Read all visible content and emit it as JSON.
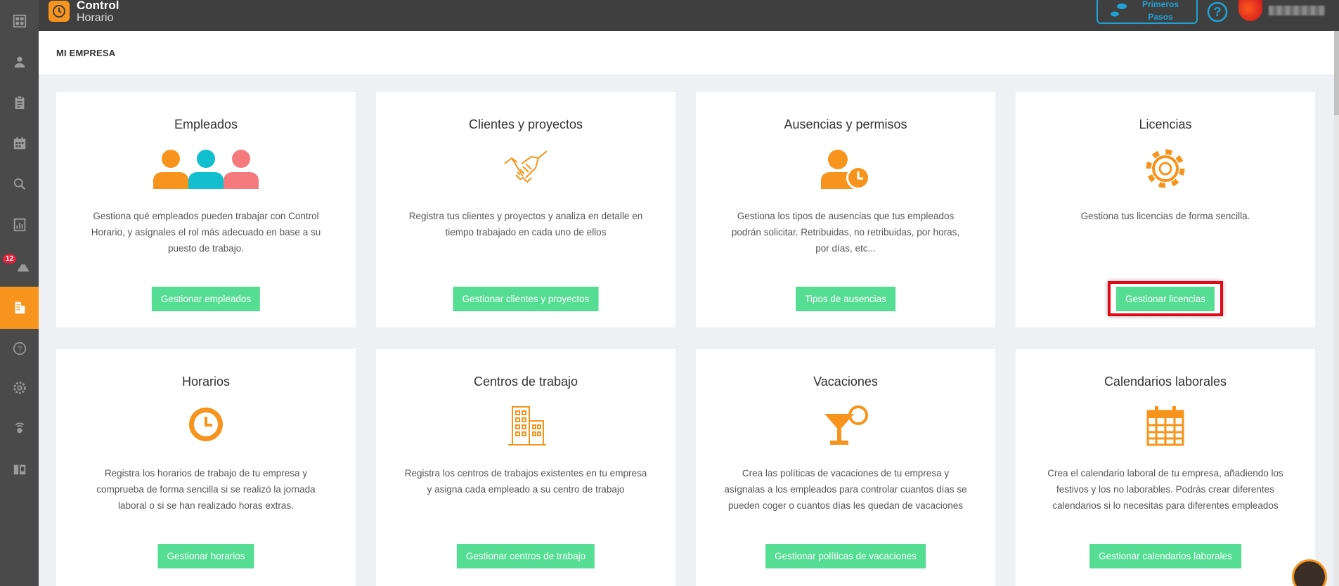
{
  "app": {
    "logo_line1": "Control",
    "logo_line2": "Horario",
    "first_steps_line1": "Primeros",
    "first_steps_line2": "Pasos"
  },
  "sidebar": {
    "badge_count": "12",
    "items": [
      {
        "icon": "dashboard-icon"
      },
      {
        "icon": "user-icon"
      },
      {
        "icon": "clipboard-icon"
      },
      {
        "icon": "calendar-icon"
      },
      {
        "icon": "search-icon"
      },
      {
        "icon": "report-icon"
      },
      {
        "icon": "vacation-icon"
      },
      {
        "icon": "company-icon",
        "active": true
      },
      {
        "icon": "help-icon"
      },
      {
        "icon": "settings-icon"
      },
      {
        "icon": "support-icon"
      },
      {
        "icon": "devices-icon"
      }
    ]
  },
  "breadcrumb": "MI EMPRESA",
  "cards": [
    {
      "title": "Empleados",
      "desc": "Gestiona qué empleados pueden trabajar con Control Horario, y asígnales el rol más adecuado en base a su puesto de trabajo.",
      "button": "Gestionar empleados",
      "icon": "employees-icon"
    },
    {
      "title": "Clientes y proyectos",
      "desc": "Registra tus clientes y proyectos y analiza en detalle en tiempo trabajado en cada uno de ellos",
      "button": "Gestionar clientes y proyectos",
      "icon": "handshake-icon"
    },
    {
      "title": "Ausencias y permisos",
      "desc": "Gestiona los tipos de ausencias que tus empleados podrán solicitar. Retribuidas, no retribuidas, por horas, por días, etc...",
      "button": "Tipos de ausencias",
      "icon": "absence-icon"
    },
    {
      "title": "Licencias",
      "desc": "Gestiona tus licencias de forma sencilla.",
      "button": "Gestionar licencias",
      "icon": "gear-icon",
      "highlighted": true
    },
    {
      "title": "Horarios",
      "desc": "Registra los horarios de trabajo de tu empresa y comprueba de forma sencilla si se realizó la jornada laboral o si se han realizado horas extras.",
      "button": "Gestionar horarios",
      "icon": "clock-icon"
    },
    {
      "title": "Centros de trabajo",
      "desc": "Registra los centros de trabajos existentes en tu empresa y asigna cada empleado a su centro de trabajo",
      "button": "Gestionar centros de trabajo",
      "icon": "building-icon"
    },
    {
      "title": "Vacaciones",
      "desc": "Crea las políticas de vacaciones de tu empresa y asígnalas a los empleados para controlar cuantos días se pueden coger o cuantos días les quedan de vacaciones",
      "button": "Gestionar políticas de vacaciones",
      "icon": "cocktail-icon"
    },
    {
      "title": "Calendarios laborales",
      "desc": "Crea el calendario laboral de tu empresa, añadiendo los festivos y los no laborables. Podrás crear diferentes calendarios si lo necesitas para diferentes empleados",
      "button": "Gestionar calendarios laborales",
      "icon": "calendar-grid-icon"
    }
  ],
  "colors": {
    "accent": "#f7941d",
    "button": "#55dd93",
    "sidebar": "#4a4a4a",
    "topbar": "#3f3f3f",
    "highlight": "#e0091a",
    "help": "#1fa3d6"
  }
}
